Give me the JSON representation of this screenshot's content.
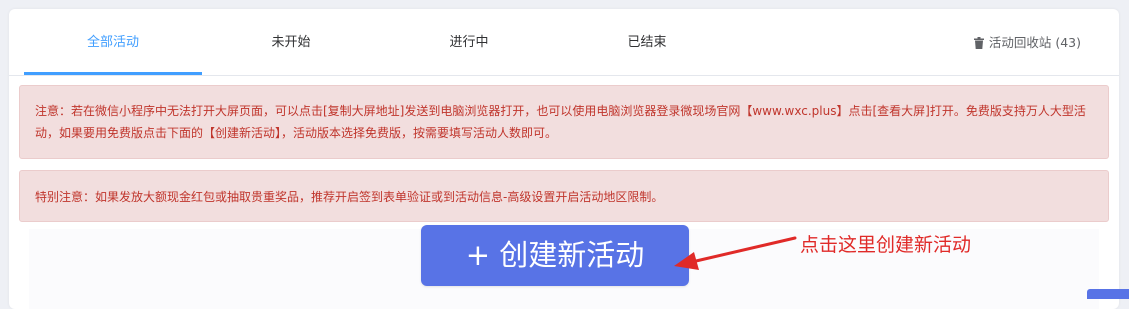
{
  "tabs": [
    {
      "label": "全部活动",
      "active": true
    },
    {
      "label": "未开始",
      "active": false
    },
    {
      "label": "进行中",
      "active": false
    },
    {
      "label": "已结束",
      "active": false
    }
  ],
  "recycle_bin": {
    "label": "活动回收站 (43)",
    "icon": "trash-icon"
  },
  "notices": [
    "注意：若在微信小程序中无法打开大屏页面，可以点击[复制大屏地址]发送到电脑浏览器打开，也可以使用电脑浏览器登录微现场官网【www.wxc.plus】点击[查看大屏]打开。免费版支持万人大型活动，如果要用免费版点击下面的【创建新活动】，活动版本选择免费版，按需要填写活动人数即可。",
    "特别注意：如果发放大额现金红包或抽取贵重奖品，推荐开启签到表单验证或到活动信息-高级设置开启活动地区限制。"
  ],
  "create_button": {
    "label": "+ 创建新活动"
  },
  "annotation": {
    "text": "点击这里创建新活动"
  },
  "colors": {
    "accent": "#409eff",
    "button": "#5873e6",
    "alert_bg": "#f2dede",
    "alert_text": "#c0352c",
    "annotation": "#e02a28"
  }
}
